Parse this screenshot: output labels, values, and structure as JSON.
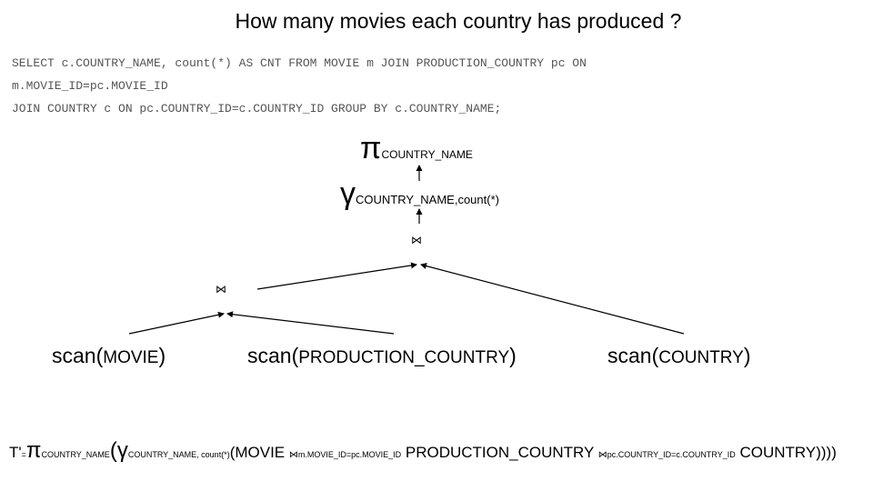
{
  "title": "How many movies each country has produced ?",
  "sql_lines": [
    "SELECT c.COUNTRY_NAME, count(*) AS CNT FROM MOVIE m JOIN PRODUCTION_COUNTRY pc ON",
    "m.MOVIE_ID=pc.MOVIE_ID",
    "JOIN COUNTRY c ON pc.COUNTRY_ID=c.COUNTRY_ID GROUP BY c.COUNTRY_NAME;"
  ],
  "tree": {
    "projection": {
      "symbol": "π",
      "subscript": "COUNTRY_NAME"
    },
    "grouping": {
      "symbol": "γ",
      "subscript": "COUNTRY_NAME,count(*)"
    },
    "join_symbol": "⋈",
    "scans": [
      {
        "prefix": "scan(",
        "arg": "MOVIE",
        "suffix": ")"
      },
      {
        "prefix": "scan(",
        "arg": "PRODUCTION_COUNTRY",
        "suffix": ")"
      },
      {
        "prefix": "scan(",
        "arg": "COUNTRY",
        "suffix": ")"
      }
    ]
  },
  "formula": {
    "lhs": "T'",
    "eq": "=",
    "pi": "π",
    "pi_sub": "COUNTRY_NAME",
    "open1": "(",
    "gamma": "γ",
    "gamma_sub": "COUNTRY_NAME, count(*)",
    "open2": "(",
    "t1": "MOVIE ",
    "join1": "⋈",
    "join1_sub": "m.MOVIE_ID=pc.MOVIE_ID",
    "t2": " PRODUCTION_COUNTRY ",
    "join2": "⋈",
    "join2_sub": "pc.COUNTRY_ID=c.COUNTRY_ID",
    "t3": " COUNTRY))))"
  }
}
